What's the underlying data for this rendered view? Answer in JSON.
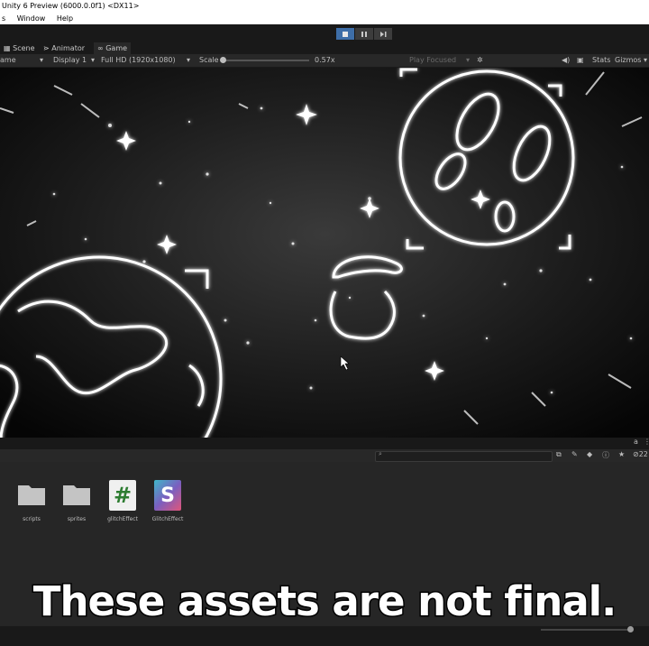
{
  "window": {
    "title": "Unity 6 Preview (6000.0.0f1) <DX11>"
  },
  "menu": {
    "items": [
      "s",
      "Window",
      "Help"
    ]
  },
  "tabs": {
    "scene": "Scene",
    "animator": "Animator",
    "game": "Game"
  },
  "game_toolbar": {
    "view": "ame",
    "display": "Display 1",
    "resolution": "Full HD (1920x1080)",
    "scale_label": "Scale",
    "scale_value": "0.57x",
    "play_focused": "Play Focused",
    "stats": "Stats",
    "gizmos": "Gizmos"
  },
  "project": {
    "assets": [
      {
        "label": "scripts",
        "icon": "folder-icon"
      },
      {
        "label": "sprites",
        "icon": "folder-icon"
      },
      {
        "label": "glitchEffect",
        "icon": "csharp-script-icon",
        "glyph": "#"
      },
      {
        "label": "GlitchEffect",
        "icon": "shader-icon",
        "glyph": "S"
      }
    ],
    "count": "22"
  },
  "caption": {
    "text": "These assets are not final."
  },
  "colors": {
    "play_active": "#3e6ea8",
    "csharp_green": "#2e7d32"
  }
}
